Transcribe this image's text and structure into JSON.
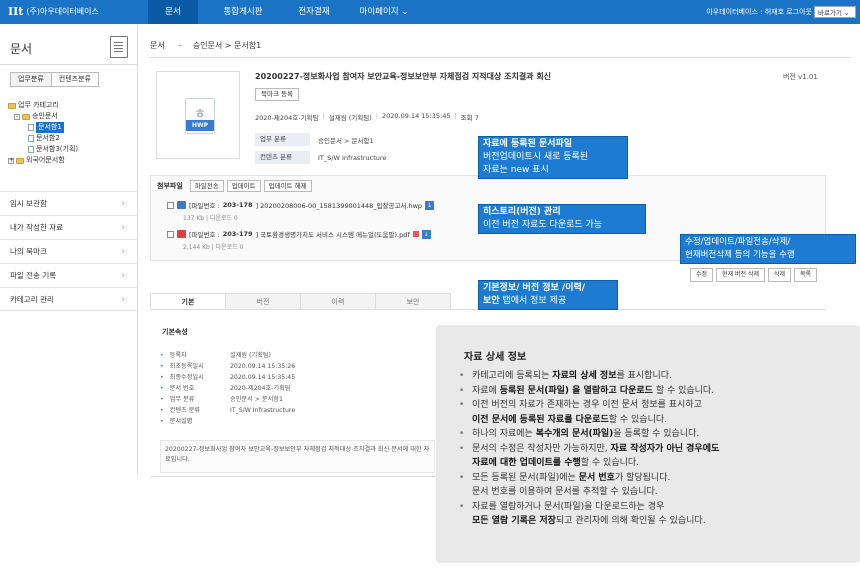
{
  "topbar": {
    "logo_mark": "IIt",
    "logo_text": "(주)아우데이터베이스",
    "nav": [
      "문서",
      "통합게시판",
      "전자결재",
      "마이페이지 ⌄"
    ],
    "user": "아우데이터베이스 : 허재호  로그아웃",
    "goto": "바로가기 ⌄"
  },
  "sidebar": {
    "title": "문서",
    "tabs": [
      "업무분류",
      "컨텐츠분류"
    ],
    "tree": {
      "root": "업무 카테고리",
      "approved": "승인문서",
      "doc1": "문서함1",
      "doc2": "문서함2",
      "doc3": "문서함3(기획)",
      "external": "외국어문서함"
    },
    "menu": [
      "임시 보관함",
      "내가 작성한 자료",
      "나의 북마크",
      "파일 전송 기록",
      "카테고리 관리"
    ]
  },
  "breadcrumb": {
    "root": "문서",
    "sep": "–",
    "path": "승인문서 > 문서함1"
  },
  "document": {
    "type_label": "HWP",
    "title": "20200227-정보화사업 참여자 보안교육-정보보안부 자체점검 지적대상 조치결과 회신",
    "version": "버전 v1.01",
    "bookmark_btn": "북마크 등록",
    "meta": [
      "2020-제204호-기획팀",
      "설재원 (기획팀)",
      "2020.09.14 15:35:45",
      "조회 7"
    ],
    "kv": [
      {
        "k": "업무 분류",
        "v": "승인문서 > 문서함1"
      },
      {
        "k": "컨텐츠 분류",
        "v": "IT_S/W Infrastructure"
      }
    ]
  },
  "attachments": {
    "title": "첨부파일",
    "buttons": [
      "파일전송",
      "업데이트",
      "업데이트 해제"
    ],
    "files": [
      {
        "prefix": "[파일번호 : ",
        "num": "203-178",
        "suffix": "] 20200208006-00_1581399001448_입찰공고서.hwp",
        "size": "137 Kb  |  다운로드 0"
      },
      {
        "prefix": "[파일번호 : ",
        "num": "203-179",
        "suffix": "] 국토환경생명가치도 서비스 시스템 메뉴얼(도움말).pdf",
        "size": "2,144 Kb  |  다운로드 0"
      }
    ]
  },
  "actions": [
    "수정",
    "현재 버전 삭제",
    "삭제",
    "목록"
  ],
  "tabs": [
    "기본",
    "버전",
    "이력",
    "보안"
  ],
  "properties": {
    "title": "기본속성",
    "rows": [
      {
        "k": "등록자",
        "v": "설재원 (기획팀)"
      },
      {
        "k": "최초등록일시",
        "v": "2020.09.14 15:35:26"
      },
      {
        "k": "최종수정일시",
        "v": "2020.09.14 15:35:45"
      },
      {
        "k": "문서 번호",
        "v": "2020-제204호-기획팀"
      },
      {
        "k": "업무 분류",
        "v": "승인문서 > 문서함1"
      },
      {
        "k": "컨텐츠 분류",
        "v": "IT_S/W Infrastructure"
      },
      {
        "k": "문서설명",
        "v": ""
      }
    ],
    "description": "20200227-정보화사업 참여자 보안교육-정보보안부 자체점검 지적대상 조치결과 회신 문서에 대한 자료입니다."
  },
  "callouts": {
    "c1_l1": "자료에 등록된 문서파일",
    "c1_l2": "버전업데이트시 새로 등록된",
    "c1_l3": "자료는 new 표시",
    "c2_l1": "히스토리(버전) 관리",
    "c2_l2": "이전 버전 자료도 다운로드 가능",
    "c3_l1": "수정/업데이트/파일전송/삭제/",
    "c3_l2": "현재버전삭제 등의 기능을 수행",
    "c4_l1": "기본정보/ 버전 정보 /이력/",
    "c4_l2a": "보안",
    "c4_l2b": " 탭에서 정보 제공"
  },
  "info": {
    "title": "자료 상세 정보",
    "items": [
      {
        "a": "카테고리에 등록되는 ",
        "b": "자료의 상세 정보",
        "c": "를 표시합니다."
      },
      {
        "a": "자료에 ",
        "b": "등록된 문서(파일) 을 열람하고 다운로드",
        "c": " 할 수 있습니다."
      },
      {
        "a": "이전 버전의 자료가 존재하는 경우 이전 문서 정보를 표시하고",
        "b2": "이전 문서에 등록된 자료를 다운로드",
        "c": "할 수 있습니다."
      },
      {
        "a": "하나의 자료에는 ",
        "b": "복수개의 문서(파일)",
        "c": "을 등록할 수 있습니다."
      },
      {
        "a": "문서의 수정은 작성자만 가능하지만, ",
        "b": "자료 작성자가 아닌 경우에도",
        "b2": "자료에 대한 업데이트를 수행",
        "c": "할 수 있습니다."
      },
      {
        "a": "모든 등록된 문서(파일)에는 ",
        "b": "문서 번호",
        "c": "가 할당됩니다.",
        "d": "문서 번호를 이용하여 문서를 추적할 수 있습니다."
      },
      {
        "a": "자료를 열람하거나 문서(파일)을 다운로드하는 경우",
        "b2": "모든 열람 기록은 저장",
        "c": "되고 관리자에 의해 확인될 수 있습니다."
      }
    ]
  },
  "colors": {
    "brand": "#1a73c4",
    "callout": "#1d7bd1",
    "panel": "#e9e9e9"
  }
}
